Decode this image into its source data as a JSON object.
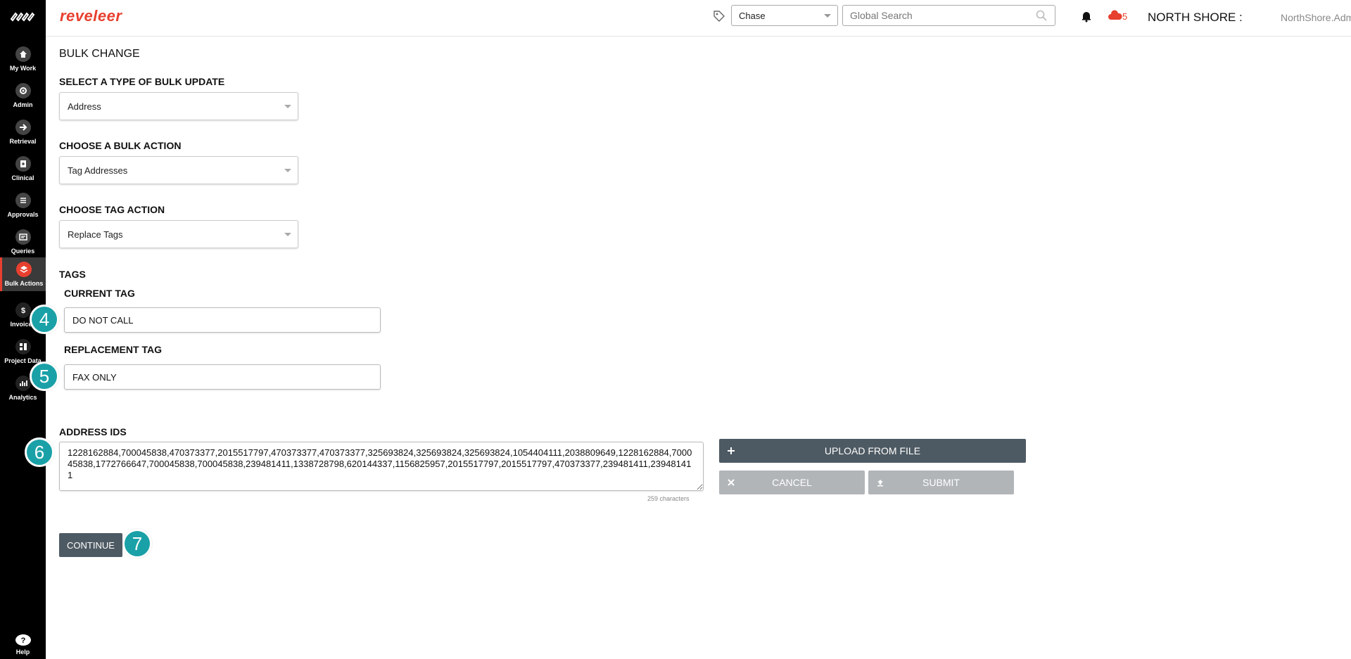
{
  "app": {
    "brand": "reveleer"
  },
  "sidebar": {
    "items": [
      {
        "label": "My Work",
        "icon": "home-icon"
      },
      {
        "label": "Admin",
        "icon": "gear-icon"
      },
      {
        "label": "Retrieval",
        "icon": "arrow-right-icon"
      },
      {
        "label": "Clinical",
        "icon": "clinical-icon"
      },
      {
        "label": "Approvals",
        "icon": "list-icon"
      },
      {
        "label": "Queries",
        "icon": "queries-icon"
      },
      {
        "label": "Bulk Actions",
        "icon": "layers-icon"
      },
      {
        "label": "Invoices",
        "icon": "dollar-icon"
      },
      {
        "label": "Project Data",
        "icon": "folder-icon"
      },
      {
        "label": "Analytics",
        "icon": "chart-icon"
      }
    ],
    "help": {
      "label": "Help",
      "icon": "help-icon"
    },
    "accent": "#e8402f"
  },
  "header": {
    "project_select": "Chase",
    "search_placeholder": "Global Search",
    "cloud_count": "5",
    "org": "NORTH SHORE :",
    "user": "NorthShore.Admin"
  },
  "main": {
    "title": "BULK CHANGE",
    "bulk_type": {
      "label": "SELECT A TYPE OF BULK UPDATE",
      "value": "Address"
    },
    "bulk_action": {
      "label": "CHOOSE A BULK ACTION",
      "value": "Tag Addresses"
    },
    "tag_action": {
      "label": "CHOOSE TAG ACTION",
      "value": "Replace Tags"
    },
    "tags": {
      "label": "TAGS",
      "current_label": "CURRENT TAG",
      "current_value": "DO NOT CALL",
      "replacement_label": "REPLACEMENT TAG",
      "replacement_value": "FAX ONLY"
    },
    "address_ids": {
      "label": "ADDRESS IDS",
      "value": "1228162884,700045838,470373377,2015517797,470373377,470373377,325693824,325693824,325693824,1054404111,2038809649,1228162884,700045838,1772766647,700045838,700045838,239481411,1338728798,620144337,1156825957,2015517797,2015517797,470373377,239481411,239481411",
      "char_count": "259 characters"
    },
    "buttons": {
      "upload": "UPLOAD FROM FILE",
      "cancel": "CANCEL",
      "submit": "SUBMIT",
      "continue": "CONTINUE"
    },
    "steps": [
      "4",
      "5",
      "6",
      "7"
    ],
    "step_color": "#1aa1a7"
  }
}
